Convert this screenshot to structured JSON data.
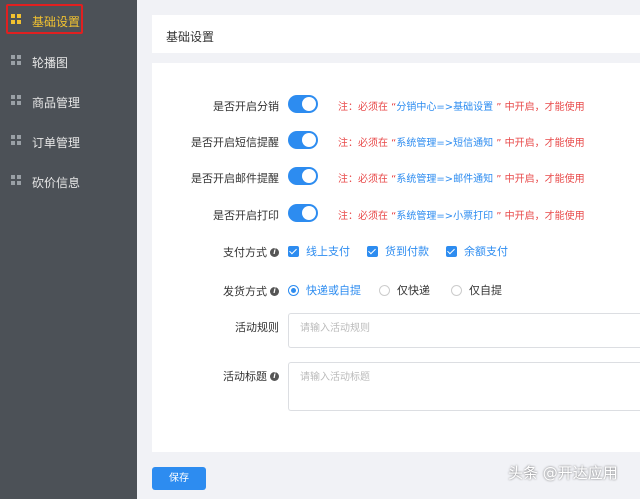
{
  "sidebar": {
    "items": [
      {
        "label": "基础设置",
        "active": true
      },
      {
        "label": "轮播图"
      },
      {
        "label": "商品管理"
      },
      {
        "label": "订单管理"
      },
      {
        "label": "砍价信息"
      }
    ]
  },
  "header": {
    "title": "基础设置"
  },
  "form": {
    "toggles": [
      {
        "label": "是否开启分销",
        "on": true,
        "note_prefix": "注：必须在 “",
        "note_link": "分销中心=>基础设置",
        "note_suffix": " ” 中开启，才能使用"
      },
      {
        "label": "是否开启短信提醒",
        "on": true,
        "note_prefix": "注：必须在 “",
        "note_link": "系统管理=>短信通知",
        "note_suffix": " ” 中开启，才能使用"
      },
      {
        "label": "是否开启邮件提醒",
        "on": true,
        "note_prefix": "注：必须在 “",
        "note_link": "系统管理=>邮件通知",
        "note_suffix": " ” 中开启，才能使用"
      },
      {
        "label": "是否开启打印",
        "on": true,
        "note_prefix": "注：必须在 “",
        "note_link": "系统管理=>小票打印",
        "note_suffix": " ” 中开启，才能使用"
      }
    ],
    "payment": {
      "label": "支付方式",
      "options": [
        {
          "label": "线上支付",
          "checked": true
        },
        {
          "label": "货到付款",
          "checked": true
        },
        {
          "label": "余额支付",
          "checked": true
        }
      ]
    },
    "delivery": {
      "label": "发货方式",
      "options": [
        {
          "label": "快递或自提",
          "selected": true
        },
        {
          "label": "仅快递",
          "selected": false
        },
        {
          "label": "仅自提",
          "selected": false
        }
      ]
    },
    "rules": {
      "label": "活动规则",
      "placeholder": "请输入活动规则"
    },
    "title": {
      "label": "活动标题",
      "placeholder": "请输入活动标题"
    }
  },
  "save_label": "保存",
  "watermark": "头条 @开达应用",
  "colors": {
    "primary": "#2d8cf0",
    "sidebar": "#4c5157",
    "active": "#f2c230",
    "note": "#e84a4a"
  }
}
